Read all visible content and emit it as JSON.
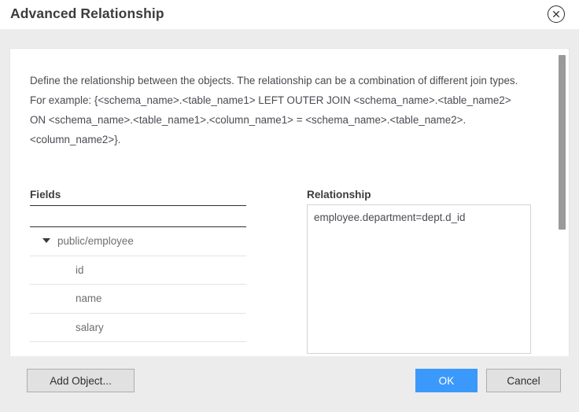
{
  "dialog": {
    "title": "Advanced Relationship",
    "close_icon": "close-circle-icon"
  },
  "description": {
    "lines": [
      "Define the relationship between the objects. The relationship can be a combination of different join types.",
      "For example: {<schema_name>.<table_name1> LEFT OUTER JOIN <schema_name>.<table_name2> ON <schema_name>.<table_name1>.<column_name1> = <schema_name>.<table_name2>.<column_name2>}."
    ]
  },
  "fields": {
    "label": "Fields",
    "tree": [
      {
        "label": "public/employee",
        "type": "group",
        "expanded": true,
        "caret_icon": "caret-down-icon"
      },
      {
        "label": "id",
        "type": "child"
      },
      {
        "label": "name",
        "type": "child"
      },
      {
        "label": "salary",
        "type": "child"
      }
    ]
  },
  "relationship": {
    "label": "Relationship",
    "value": "employee.department=dept.d_id",
    "placeholder": ""
  },
  "scrollbar": {
    "orientation": "vertical",
    "thumb_name": "panel-scrollbar-thumb"
  },
  "footer": {
    "add_object_label": "Add Object...",
    "ok_label": "OK",
    "cancel_label": "Cancel"
  },
  "colors": {
    "accent": "#3b99fc",
    "title_text": "#3c3c3c",
    "body_text": "#4a4a52",
    "panel_bg": "#ffffff",
    "dialog_bg": "#ececec",
    "rule": "#2f2f2f",
    "row_divider": "#e4e4e4",
    "scrollbar_thumb": "#9a9a9a"
  }
}
